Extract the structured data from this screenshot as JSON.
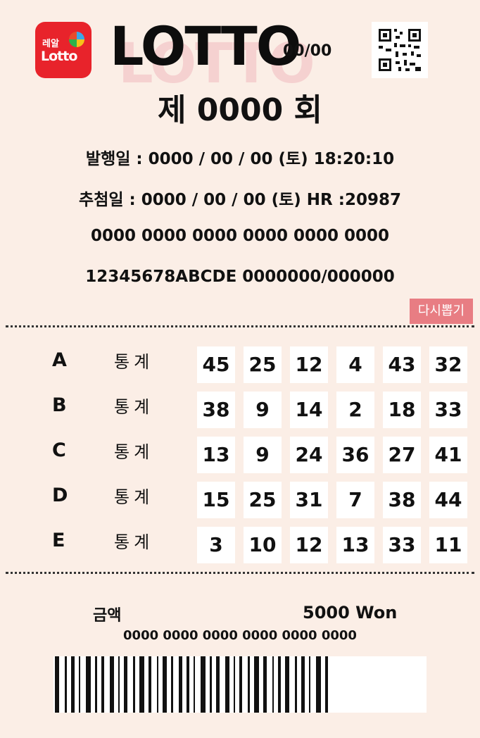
{
  "header": {
    "logo_small": "레알",
    "logo_big": "Lotto",
    "brand": "LOTTO",
    "brand_date": "00/00"
  },
  "round_title": "제 0000 회",
  "info": {
    "issue": "발행일 : 0000 / 00 / 00 (토) 18:20:10",
    "draw": "추첨일 : 0000 / 00 / 00 (토) HR :20987",
    "serial": "0000 0000 0000 0000 0000 0000",
    "code": "12345678ABCDE 0000000/000000"
  },
  "retry_button": "다시뽑기",
  "games": [
    {
      "letter": "A",
      "stat": "통계",
      "numbers": [
        "45",
        "25",
        "12",
        "4",
        "43",
        "32"
      ]
    },
    {
      "letter": "B",
      "stat": "통계",
      "numbers": [
        "38",
        "9",
        "14",
        "2",
        "18",
        "33"
      ]
    },
    {
      "letter": "C",
      "stat": "통계",
      "numbers": [
        "13",
        "9",
        "24",
        "36",
        "27",
        "41"
      ]
    },
    {
      "letter": "D",
      "stat": "통계",
      "numbers": [
        "15",
        "25",
        "31",
        "7",
        "38",
        "44"
      ]
    },
    {
      "letter": "E",
      "stat": "통계",
      "numbers": [
        "3",
        "10",
        "12",
        "13",
        "33",
        "11"
      ]
    }
  ],
  "amount": {
    "label": "금액",
    "value": "5000 Won"
  },
  "bottom_serial": "0000 0000 0000 0000 0000 0000",
  "icons": {
    "logo": "lotto-logo-icon",
    "qr": "qr-code-icon",
    "barcode": "barcode-icon"
  },
  "colors": {
    "logo_red": "#e8232b",
    "retry_button": "#e87d83",
    "background": "#fbeee6"
  }
}
